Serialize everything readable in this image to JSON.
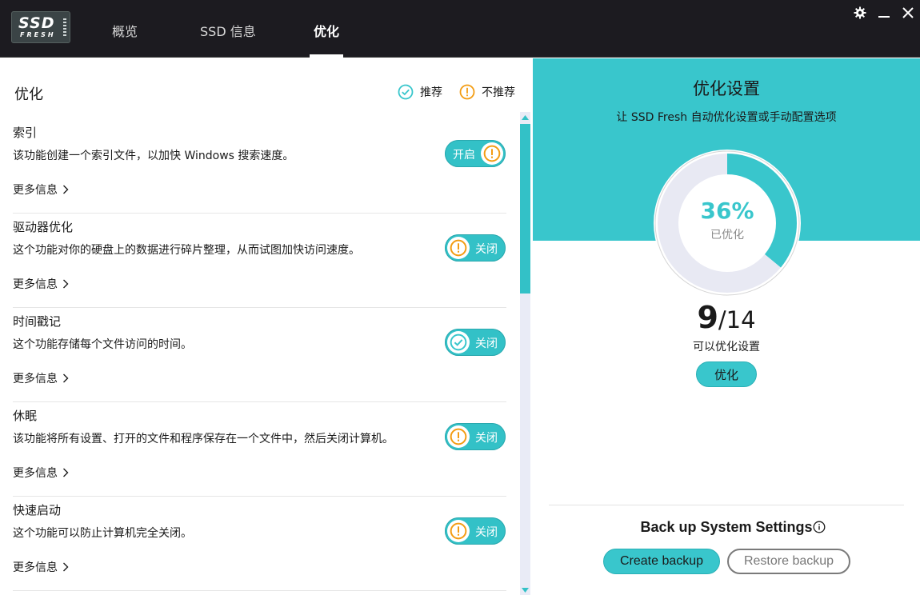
{
  "app": {
    "logo_line1": "SSD",
    "logo_line2": "FRESH"
  },
  "tabs": [
    {
      "label": "概览"
    },
    {
      "label": "SSD 信息"
    },
    {
      "label": "优化"
    }
  ],
  "left": {
    "title": "优化",
    "legend_recommended": "推荐",
    "legend_not_recommended": "不推荐",
    "more_info": "更多信息",
    "items": [
      {
        "name": "索引",
        "desc": "该功能创建一个索引文件，以加快 Windows 搜索速度。",
        "state": "开启",
        "icon": "warning-icon"
      },
      {
        "name": "驱动器优化",
        "desc": "这个功能对你的硬盘上的数据进行碎片整理，从而试图加快访问速度。",
        "state": "关闭",
        "icon": "warning-icon"
      },
      {
        "name": "时间戳记",
        "desc": "这个功能存储每个文件访问的时间。",
        "state": "关闭",
        "icon": "check-icon"
      },
      {
        "name": "休眠",
        "desc": "该功能将所有设置、打开的文件和程序保存在一个文件中，然后关闭计算机。",
        "state": "关闭",
        "icon": "warning-icon"
      },
      {
        "name": "快速启动",
        "desc": "这个功能可以防止计算机完全关闭。",
        "state": "关闭",
        "icon": "warning-icon"
      }
    ]
  },
  "right": {
    "title": "优化设置",
    "subtitle": "让 SSD Fresh 自动优化设置或手动配置选项",
    "gauge_percent": "36%",
    "gauge_value": 0.36,
    "gauge_label": "已优化",
    "count_current": "9",
    "count_total": "/14",
    "count_label": "可以优化设置",
    "optimize_button": "优化",
    "backup_title": "Back up System Settings",
    "create_backup": "Create backup",
    "restore_backup": "Restore backup"
  },
  "colors": {
    "accent": "#39c6cc",
    "warning": "#f39c12",
    "titlebar": "#1c1b20"
  }
}
